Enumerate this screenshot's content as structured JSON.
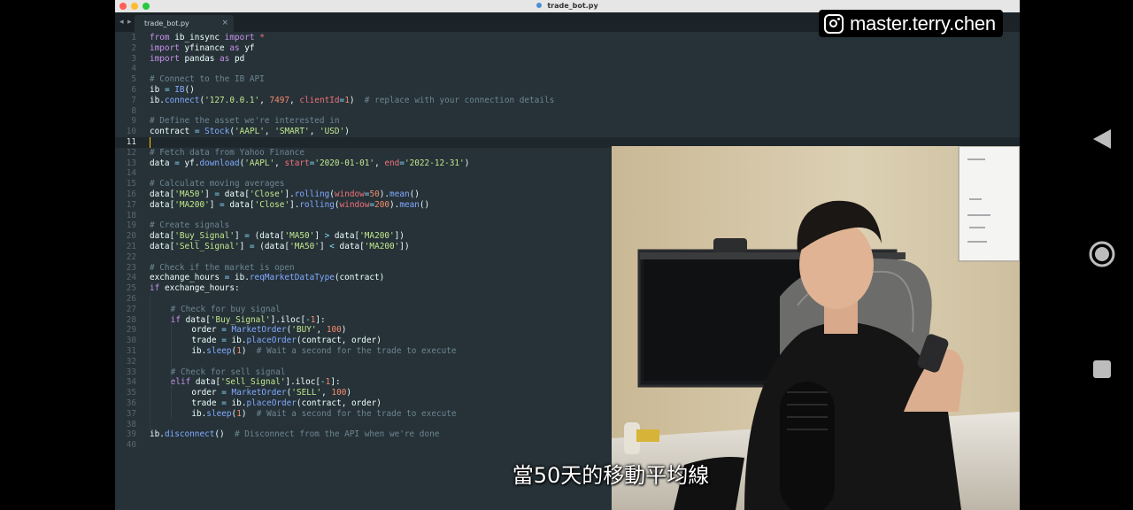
{
  "window": {
    "title": "trade_bot.py",
    "tab_label": "trade_bot.py",
    "tab_close": "×",
    "nav_back": "◂",
    "nav_forward": "▸"
  },
  "editor": {
    "current_line": 11,
    "lines": [
      {
        "n": "1",
        "indent": 0,
        "html": "<span class=\"kw\">from</span> ib_insync <span class=\"kw\">import</span> <span class=\"pm\">*</span>"
      },
      {
        "n": "2",
        "indent": 0,
        "html": "<span class=\"kw\">import</span> yfinance <span class=\"kw\">as</span> yf"
      },
      {
        "n": "3",
        "indent": 0,
        "html": "<span class=\"kw\">import</span> pandas <span class=\"kw\">as</span> pd"
      },
      {
        "n": "4",
        "indent": 0,
        "html": ""
      },
      {
        "n": "5",
        "indent": 0,
        "html": "<span class=\"cm\"># Connect to the IB API</span>"
      },
      {
        "n": "6",
        "indent": 0,
        "html": "ib <span class=\"op\">=</span> <span class=\"fn\">IB</span>()"
      },
      {
        "n": "7",
        "indent": 0,
        "html": "ib.<span class=\"fn\">connect</span>(<span class=\"st\">'127.0.0.1'</span>, <span class=\"nu\">7497</span>, <span class=\"pm\">clientId</span><span class=\"op\">=</span><span class=\"nu\">1</span>)  <span class=\"cm\"># replace with your connection details</span>"
      },
      {
        "n": "8",
        "indent": 0,
        "html": ""
      },
      {
        "n": "9",
        "indent": 0,
        "html": "<span class=\"cm\"># Define the asset we're interested in</span>"
      },
      {
        "n": "10",
        "indent": 0,
        "html": "contract <span class=\"op\">=</span> <span class=\"fn\">Stock</span>(<span class=\"st\">'AAPL'</span>, <span class=\"st\">'SMART'</span>, <span class=\"st\">'USD'</span>)"
      },
      {
        "n": "11",
        "indent": 0,
        "html": ""
      },
      {
        "n": "12",
        "indent": 0,
        "html": "<span class=\"cm\"># Fetch data from Yahoo Finance</span>"
      },
      {
        "n": "13",
        "indent": 0,
        "html": "data <span class=\"op\">=</span> yf.<span class=\"fn\">download</span>(<span class=\"st\">'AAPL'</span>, <span class=\"pm\">start</span><span class=\"op\">=</span><span class=\"st\">'2020-01-01'</span>, <span class=\"pm\">end</span><span class=\"op\">=</span><span class=\"st\">'2022-12-31'</span>)"
      },
      {
        "n": "14",
        "indent": 0,
        "html": ""
      },
      {
        "n": "15",
        "indent": 0,
        "html": "<span class=\"cm\"># Calculate moving averages</span>"
      },
      {
        "n": "16",
        "indent": 0,
        "html": "data[<span class=\"st\">'MA50'</span>] <span class=\"op\">=</span> data[<span class=\"st\">'Close'</span>].<span class=\"fn\">rolling</span>(<span class=\"pm\">window</span><span class=\"op\">=</span><span class=\"nu\">50</span>).<span class=\"fn\">mean</span>()"
      },
      {
        "n": "17",
        "indent": 0,
        "html": "data[<span class=\"st\">'MA200'</span>] <span class=\"op\">=</span> data[<span class=\"st\">'Close'</span>].<span class=\"fn\">rolling</span>(<span class=\"pm\">window</span><span class=\"op\">=</span><span class=\"nu\">200</span>).<span class=\"fn\">mean</span>()"
      },
      {
        "n": "18",
        "indent": 0,
        "html": ""
      },
      {
        "n": "19",
        "indent": 0,
        "html": "<span class=\"cm\"># Create signals</span>"
      },
      {
        "n": "20",
        "indent": 0,
        "html": "data[<span class=\"st\">'Buy_Signal'</span>] <span class=\"op\">=</span> (data[<span class=\"st\">'MA50'</span>] <span class=\"op\">&gt;</span> data[<span class=\"st\">'MA200'</span>])"
      },
      {
        "n": "21",
        "indent": 0,
        "html": "data[<span class=\"st\">'Sell_Signal'</span>] <span class=\"op\">=</span> (data[<span class=\"st\">'MA50'</span>] <span class=\"op\">&lt;</span> data[<span class=\"st\">'MA200'</span>])"
      },
      {
        "n": "22",
        "indent": 0,
        "html": ""
      },
      {
        "n": "23",
        "indent": 0,
        "html": "<span class=\"cm\"># Check if the market is open</span>"
      },
      {
        "n": "24",
        "indent": 0,
        "html": "exchange_hours <span class=\"op\">=</span> ib.<span class=\"fn\">reqMarketDataType</span>(contract)"
      },
      {
        "n": "25",
        "indent": 0,
        "html": "<span class=\"kw\">if</span> exchange_hours:"
      },
      {
        "n": "26",
        "indent": 0,
        "html": ""
      },
      {
        "n": "27",
        "indent": 1,
        "html": "<span class=\"cm\"># Check for buy signal</span>"
      },
      {
        "n": "28",
        "indent": 1,
        "html": "<span class=\"kw\">if</span> data[<span class=\"st\">'Buy_Signal'</span>].iloc[<span class=\"op\">-</span><span class=\"nu\">1</span>]:"
      },
      {
        "n": "29",
        "indent": 2,
        "html": "order <span class=\"op\">=</span> <span class=\"fn\">MarketOrder</span>(<span class=\"st\">'BUY'</span>, <span class=\"nu\">100</span>)"
      },
      {
        "n": "30",
        "indent": 2,
        "html": "trade <span class=\"op\">=</span> ib.<span class=\"fn\">placeOrder</span>(contract, order)"
      },
      {
        "n": "31",
        "indent": 2,
        "html": "ib.<span class=\"fn\">sleep</span>(<span class=\"nu\">1</span>)  <span class=\"cm\"># Wait a second for the trade to execute</span>"
      },
      {
        "n": "32",
        "indent": 0,
        "html": ""
      },
      {
        "n": "33",
        "indent": 1,
        "html": "<span class=\"cm\"># Check for sell signal</span>"
      },
      {
        "n": "34",
        "indent": 1,
        "html": "<span class=\"kw\">elif</span> data[<span class=\"st\">'Sell_Signal'</span>].iloc[<span class=\"op\">-</span><span class=\"nu\">1</span>]:"
      },
      {
        "n": "35",
        "indent": 2,
        "html": "order <span class=\"op\">=</span> <span class=\"fn\">MarketOrder</span>(<span class=\"st\">'SELL'</span>, <span class=\"nu\">100</span>)"
      },
      {
        "n": "36",
        "indent": 2,
        "html": "trade <span class=\"op\">=</span> ib.<span class=\"fn\">placeOrder</span>(contract, order)"
      },
      {
        "n": "37",
        "indent": 2,
        "html": "ib.<span class=\"fn\">sleep</span>(<span class=\"nu\">1</span>)  <span class=\"cm\"># Wait a second for the trade to execute</span>"
      },
      {
        "n": "38",
        "indent": 0,
        "html": ""
      },
      {
        "n": "39",
        "indent": 0,
        "html": "ib.<span class=\"fn\">disconnect</span>()  <span class=\"cm\"># Disconnect from the API when we're done</span>"
      },
      {
        "n": "40",
        "indent": 0,
        "html": ""
      }
    ]
  },
  "watermark": {
    "icon": "instagram-icon",
    "handle": "master.terry.chen"
  },
  "subtitle": "當50天的移動平均線",
  "android_nav": {
    "back_icon": "back-triangle-icon",
    "home_icon": "home-circle-icon",
    "recents_icon": "recents-square-icon"
  }
}
